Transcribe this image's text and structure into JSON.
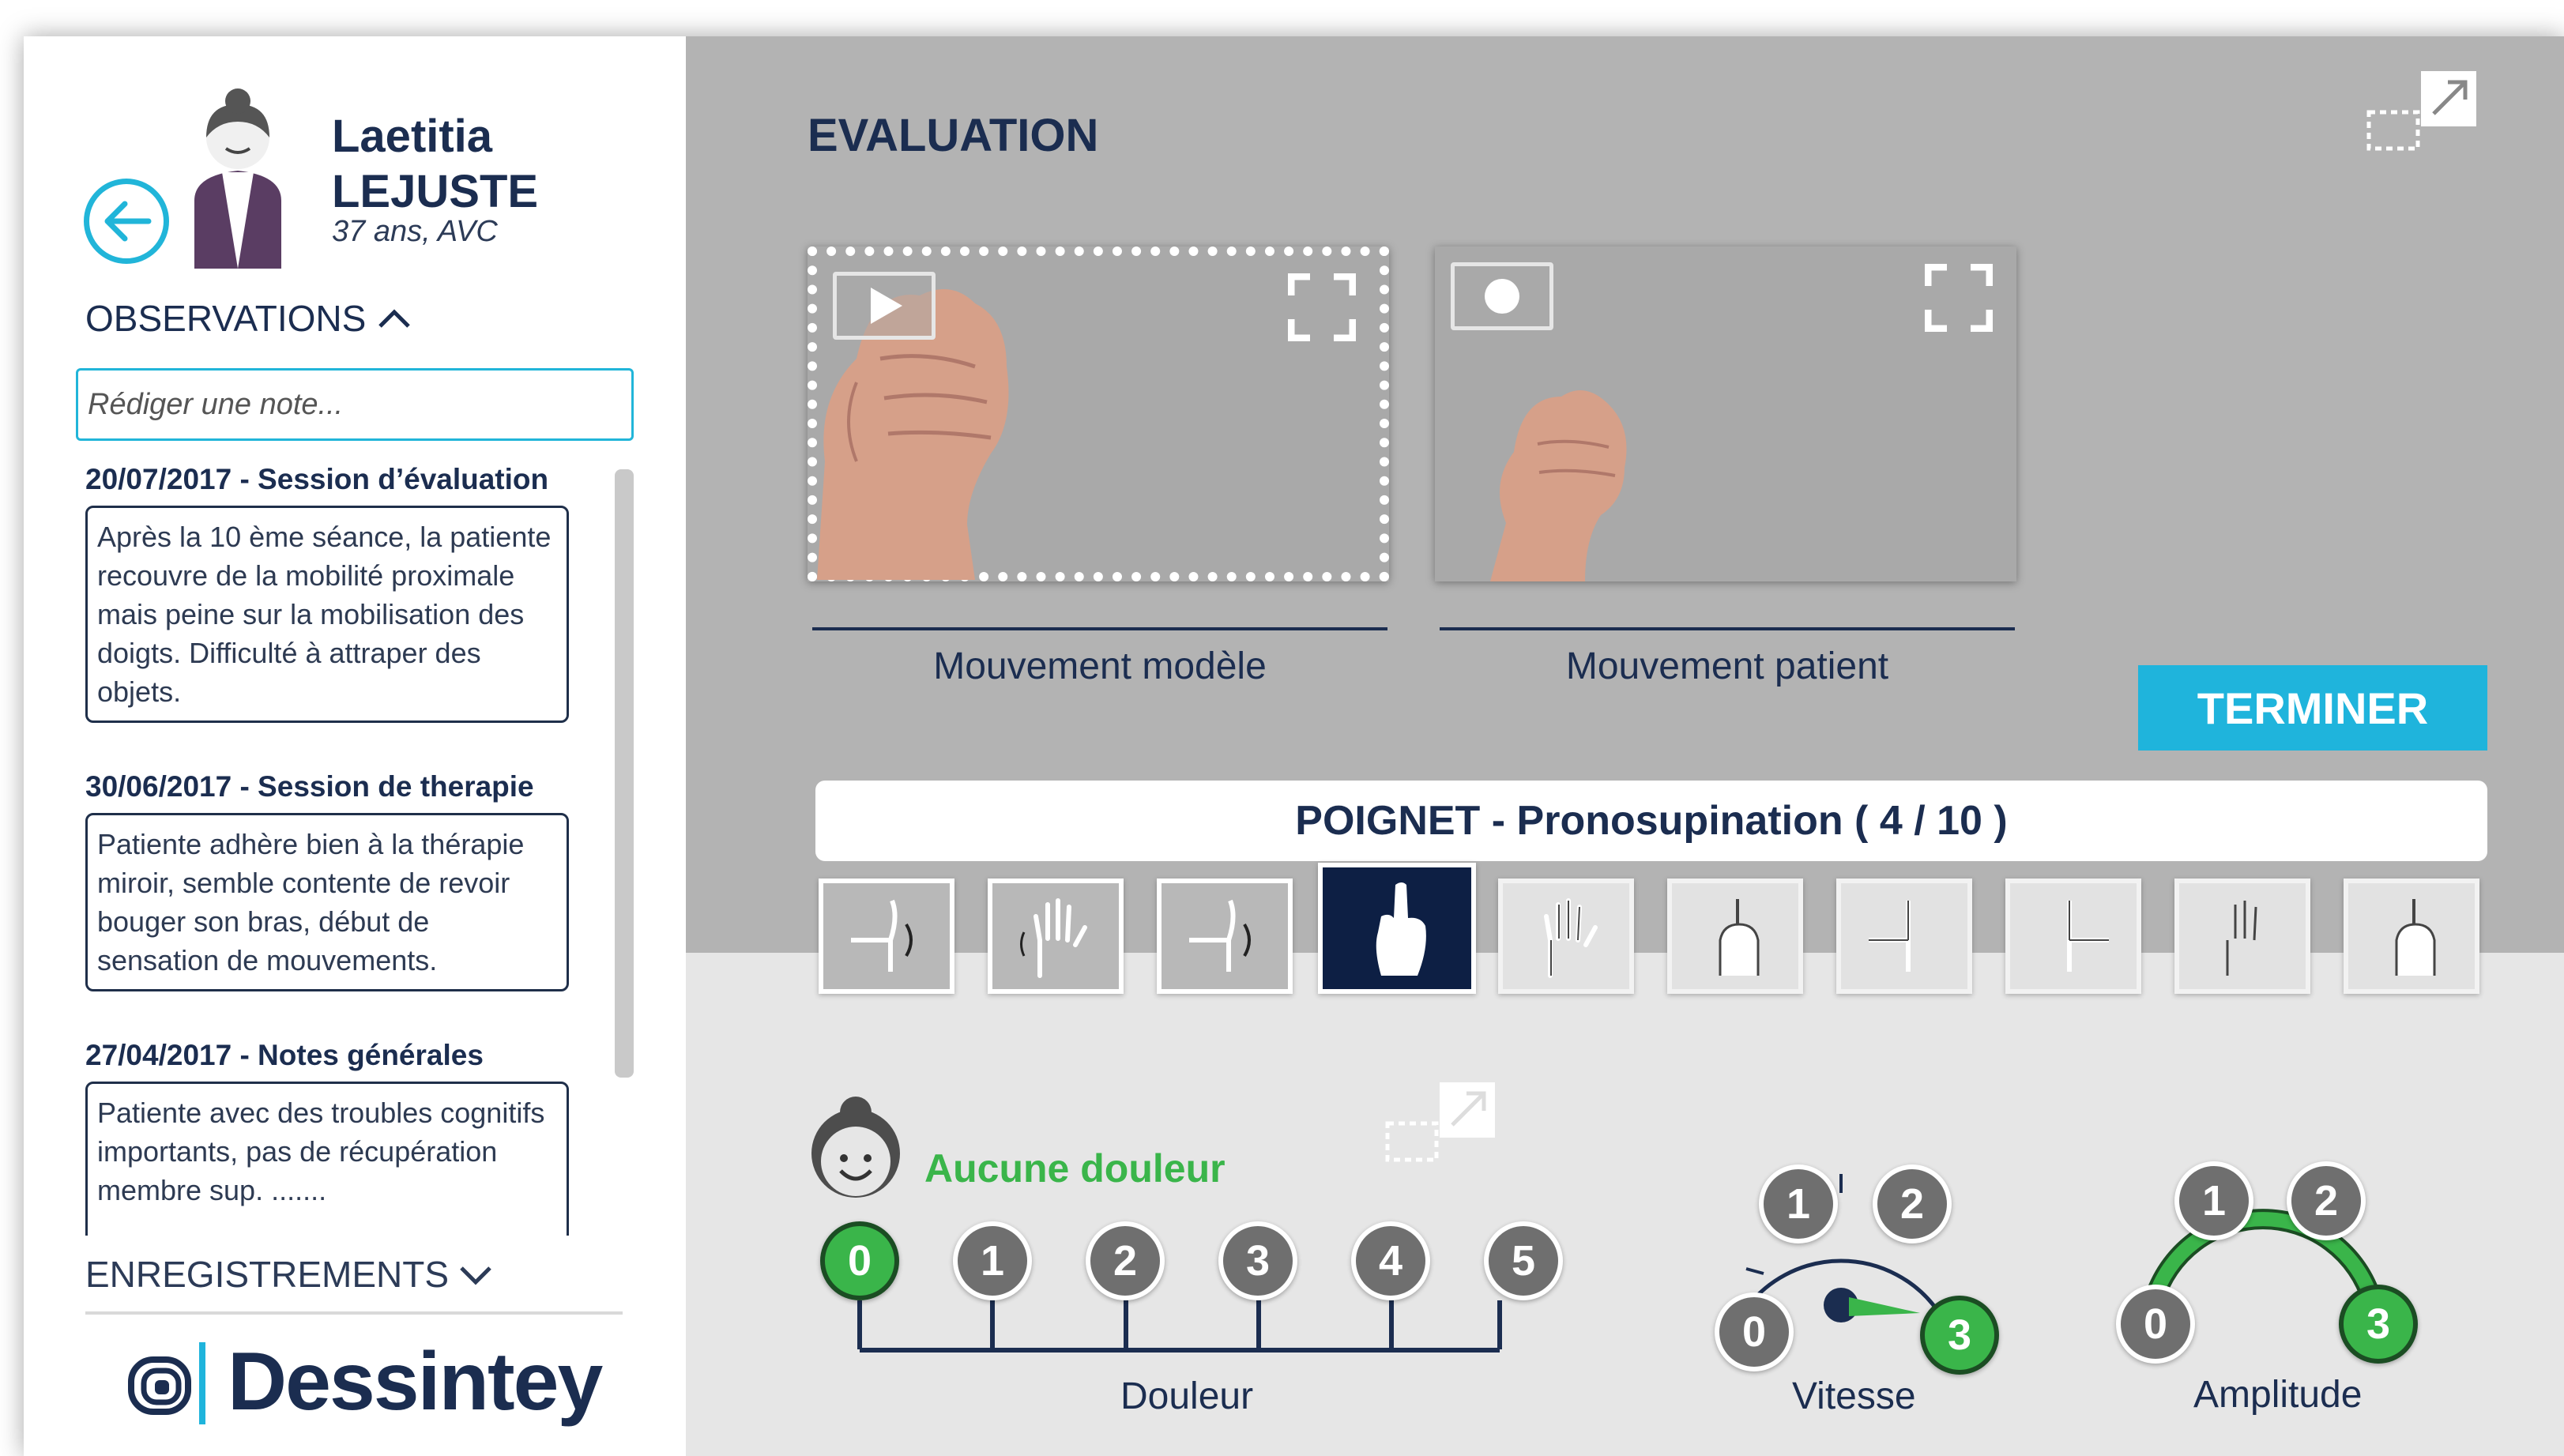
{
  "patient": {
    "first_name": "Laetitia",
    "last_name": "LEJUSTE",
    "details": "37 ans, AVC"
  },
  "observations": {
    "title": "OBSERVATIONS",
    "note_placeholder": "Rédiger une note...",
    "notes": [
      {
        "date_title": "20/07/2017 - Session d’évaluation",
        "text": "Après la 10 ème séance, la patiente recouvre de la mobilité proximale mais peine sur la mobilisation des doigts. Difficulté à attraper des objets."
      },
      {
        "date_title": "30/06/2017 - Session de therapie",
        "text": "Patiente adhère bien à la thérapie miroir, semble contente de revoir bouger son bras, début de sensation de mouvements."
      },
      {
        "date_title": "27/04/2017 - Notes générales",
        "text": "Patiente avec des troubles cognitifs importants, pas de récupération membre sup. ......."
      }
    ]
  },
  "recordings": {
    "title": "ENREGISTREMENTS"
  },
  "brand": {
    "logo_text": "Dessintey"
  },
  "evaluation": {
    "title": "EVALUATION",
    "video_model_label": "Mouvement modèle",
    "video_patient_label": "Mouvement patient",
    "finish_label": "TERMINER",
    "exercise_title": "POIGNET - Pronosupination ( 4 / 10 )",
    "exercise_current": 4,
    "exercise_total": 10
  },
  "pain": {
    "status": "Aucune douleur",
    "label": "Douleur",
    "scale": [
      "0",
      "1",
      "2",
      "3",
      "4",
      "5"
    ],
    "selected": 0
  },
  "speed": {
    "label": "Vitesse",
    "scale": [
      "0",
      "1",
      "2",
      "3"
    ],
    "selected": 3
  },
  "amplitude": {
    "label": "Amplitude",
    "scale": [
      "0",
      "1",
      "2",
      "3"
    ],
    "selected": 3
  },
  "colors": {
    "accent": "#1fb4dc",
    "navy": "#1b2d50",
    "success": "#3ab54a",
    "panel_grey": "#b3b3b3"
  }
}
